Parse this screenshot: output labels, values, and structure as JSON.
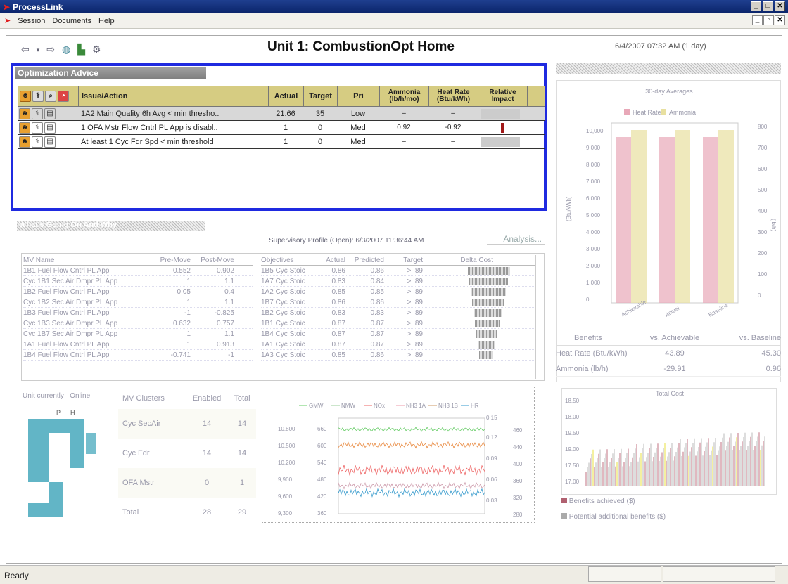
{
  "window": {
    "title": "ProcessLink"
  },
  "menu": [
    "Session",
    "Documents",
    "Help"
  ],
  "page": {
    "title": "Unit 1: CombustionOpt Home",
    "datetime": "6/4/2007 07:32 AM (1 day)"
  },
  "advice": {
    "header": "Optimization Advice",
    "columns": {
      "issue": "Issue/Action",
      "actual": "Actual",
      "target": "Target",
      "pri": "Pri",
      "ammonia": "Ammonia (lb/h/mo)",
      "heatrate": "Heat Rate (Btu/kWh)",
      "impact": "Relative Impact"
    },
    "rows": [
      {
        "issue": "1A2  Main Quality 6h Avg < min thresho..",
        "actual": "21.66",
        "target": "35",
        "pri": "Low",
        "ammonia": "–",
        "heatrate": "–"
      },
      {
        "issue": "1 OFA Mstr Flow Cntrl PL App is disabl..",
        "actual": "1",
        "target": "0",
        "pri": "Med",
        "ammonia": "0.92",
        "heatrate": "-0.92"
      },
      {
        "issue": "At least 1 Cyc Fdr Spd < min threshold",
        "actual": "1",
        "target": "0",
        "pri": "Med",
        "ammonia": "–",
        "heatrate": "–"
      }
    ]
  },
  "supervisory": {
    "section_title": "What's Going On And Why",
    "profile": "Supervisory Profile (Open): 6/3/2007 11:36:44 AM",
    "analysis_btn": "Analysis...",
    "mv_headers": [
      "MV Name",
      "Pre-Move",
      "Post-Move"
    ],
    "mv_rows": [
      [
        "1B1 Fuel Flow Cntrl PL App",
        "0.552",
        "0.902"
      ],
      [
        "Cyc 1B1 Sec Air Dmpr PL App",
        "1",
        "1.1"
      ],
      [
        "1B2 Fuel Flow Cntrl PL App",
        "0.05",
        "0.4"
      ],
      [
        "Cyc 1B2 Sec Air Dmpr PL App",
        "1",
        "1.1"
      ],
      [
        "1B3 Fuel Flow Cntrl PL App",
        "-1",
        "-0.825"
      ],
      [
        "Cyc 1B3 Sec Air Dmpr PL App",
        "0.632",
        "0.757"
      ],
      [
        "Cyc 1B7 Sec Air Dmpr PL App",
        "1",
        "1.1"
      ],
      [
        "1A1 Fuel Flow Cntrl PL App",
        "1",
        "0.913"
      ],
      [
        "1B4 Fuel Flow Cntrl PL App",
        "-0.741",
        "-1"
      ]
    ],
    "obj_headers": [
      "Objectives",
      "Actual",
      "Predicted",
      "Target",
      "Delta Cost"
    ],
    "obj_rows": [
      [
        "1B5 Cyc Stoic",
        "0.86",
        "0.86",
        "> .89"
      ],
      [
        "1A7 Cyc Stoic",
        "0.83",
        "0.84",
        "> .89"
      ],
      [
        "1A2 Cyc Stoic",
        "0.85",
        "0.85",
        "> .89"
      ],
      [
        "1B7 Cyc Stoic",
        "0.86",
        "0.86",
        "> .89"
      ],
      [
        "1B2 Cyc Stoic",
        "0.83",
        "0.83",
        "> .89"
      ],
      [
        "1B1 Cyc Stoic",
        "0.87",
        "0.87",
        "> .89"
      ],
      [
        "1B4 Cyc Stoic",
        "0.87",
        "0.87",
        "> .89"
      ],
      [
        "1A1 Cyc Stoic",
        "0.87",
        "0.87",
        "> .89"
      ],
      [
        "1A3 Cyc Stoic",
        "0.85",
        "0.86",
        "> .89"
      ]
    ]
  },
  "unit": {
    "label": "Unit currently",
    "status": "Online"
  },
  "clusters": {
    "headers": [
      "MV Clusters",
      "Enabled",
      "Total"
    ],
    "rows": [
      [
        "Cyc SecAir",
        "14",
        "14"
      ],
      [
        "Cyc Fdr",
        "14",
        "14"
      ],
      [
        "OFA Mstr",
        "0",
        "1"
      ],
      [
        "Total",
        "28",
        "29"
      ]
    ]
  },
  "trend": {
    "legend": [
      "GMW",
      "NMW",
      "NOx",
      "NH3 1A",
      "NH3 1B",
      "HR"
    ]
  },
  "bar30": {
    "title": "30-day Averages",
    "legend": [
      "Heat Rate",
      "Ammonia"
    ],
    "categories": [
      "Achievable",
      "Actual",
      "Baseline"
    ],
    "yleft": [
      "10,000",
      "9,000",
      "8,000",
      "7,000",
      "6,000",
      "5,000",
      "4,000",
      "3,000",
      "2,000",
      "1,000",
      "0"
    ],
    "yright": [
      "800",
      "700",
      "600",
      "500",
      "400",
      "300",
      "200",
      "100",
      "0"
    ],
    "ylabel_left": "(Btu/kWh)",
    "ylabel_right": "(lb/h)"
  },
  "benefits": {
    "headers": [
      "Benefits",
      "vs. Achievable",
      "vs. Baseline"
    ],
    "rows": [
      [
        "Heat Rate (Btu/kWh)",
        "43.89",
        "45.30"
      ],
      [
        "Ammonia (lb/h)",
        "-29.91",
        "0.96"
      ]
    ]
  },
  "totalcost": {
    "title": "Total Cost",
    "yticks": [
      "18.50",
      "18.00",
      "19.50",
      "19.00",
      "17.50",
      "17.00"
    ],
    "legend": [
      "Benefits achieved ($)",
      "Potential additional benefits ($)"
    ]
  },
  "status": {
    "text": "Ready"
  }
}
